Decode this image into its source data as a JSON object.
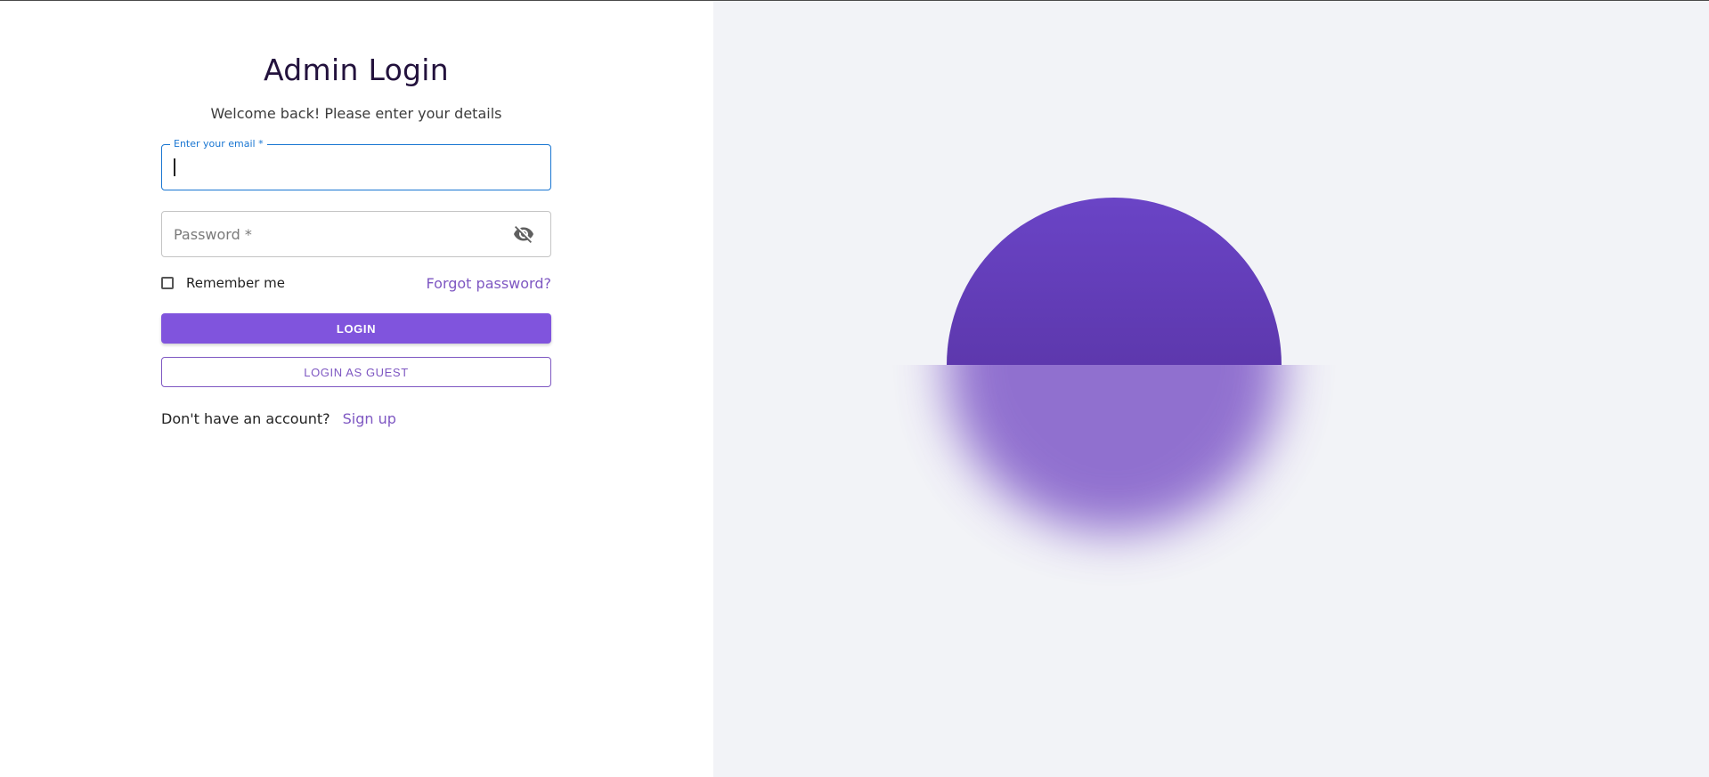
{
  "login": {
    "title": "Admin Login",
    "subtitle": "Welcome back! Please enter your details",
    "email_label": "Enter your email *",
    "email_value": "",
    "password_placeholder": "Password *",
    "password_value": "",
    "remember_label": "Remember me",
    "forgot_label": "Forgot password?",
    "login_button": "LOGIN",
    "guest_button": "LOGIN AS GUEST",
    "signup_prompt": "Don't have an account?",
    "signup_link": "Sign up"
  },
  "icons": {
    "password_toggle": "eye-off-icon"
  },
  "colors": {
    "accent": "#8054dd",
    "link": "#7e57c2",
    "focus": "#1976d2",
    "right_background": "#f2f3f7",
    "orb": "#6a44c6"
  }
}
